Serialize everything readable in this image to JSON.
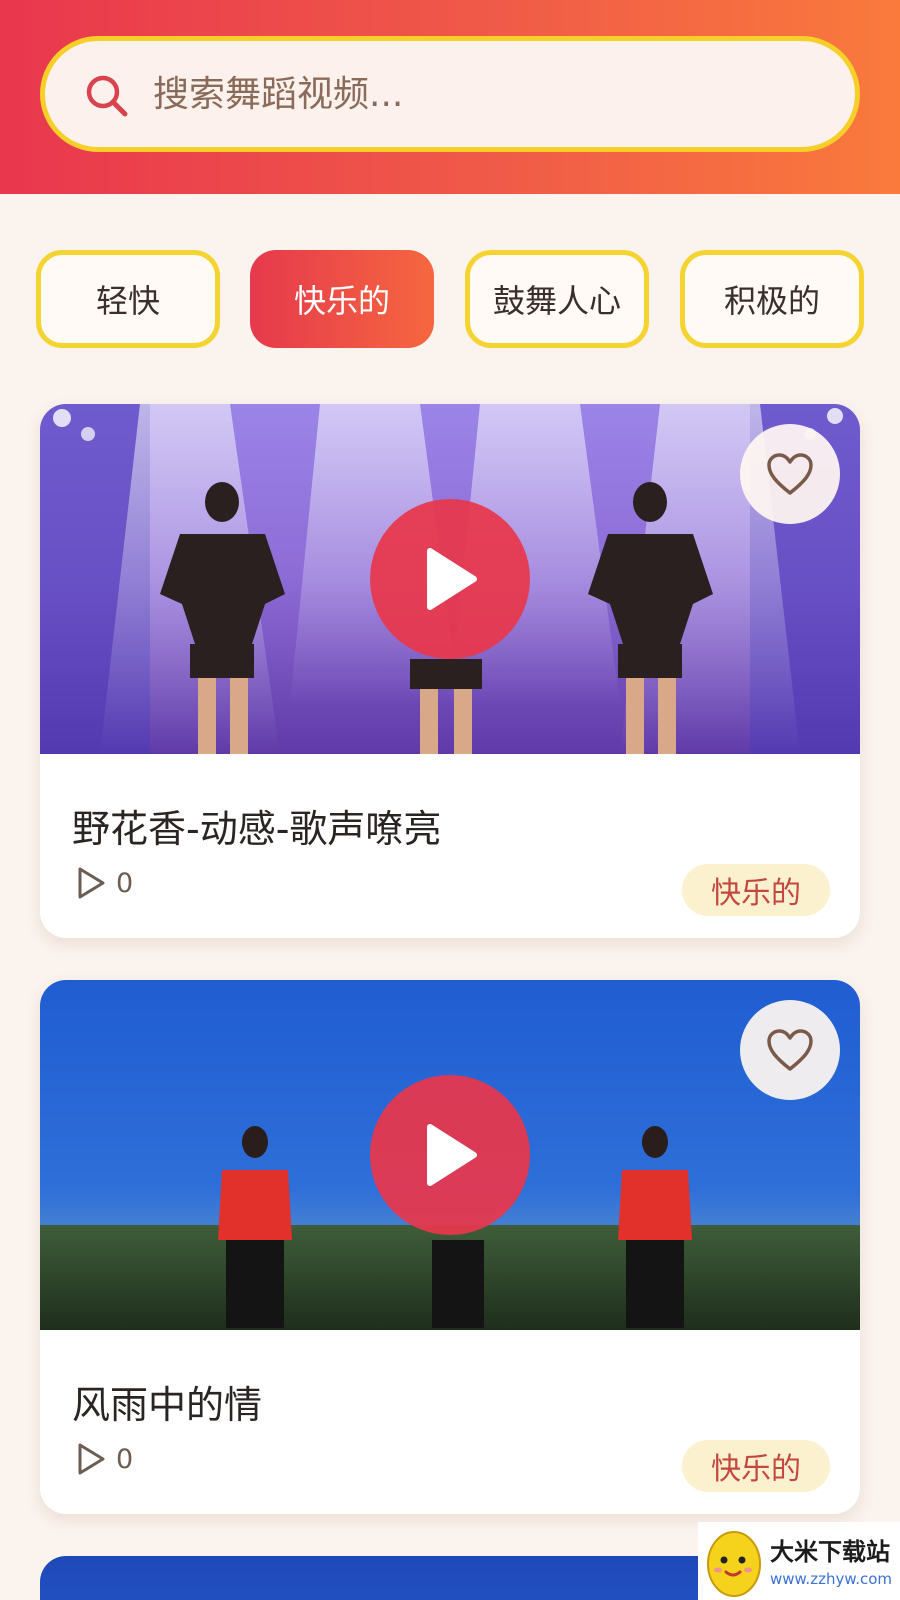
{
  "search": {
    "placeholder": "搜索舞蹈视频..."
  },
  "filters": [
    {
      "label": "轻快",
      "active": false
    },
    {
      "label": "快乐的",
      "active": true
    },
    {
      "label": "鼓舞人心",
      "active": false
    },
    {
      "label": "积极的",
      "active": false
    }
  ],
  "videos": [
    {
      "title": "野花香-动感-歌声嘹亮",
      "plays": "0",
      "tag": "快乐的"
    },
    {
      "title": "风雨中的情",
      "plays": "0",
      "tag": "快乐的"
    }
  ],
  "watermark": {
    "name": "大米下载站",
    "url": "www.zzhyw.com"
  },
  "colors": {
    "header_start": "#e9374e",
    "header_end": "#fa7a3c",
    "accent_yellow": "#f7cf29",
    "play_red": "#e8374b",
    "tag_bg": "#fcf1cf",
    "tag_text": "#c44840"
  },
  "icons": [
    "search-icon",
    "heart-icon",
    "play-icon",
    "play-count-icon"
  ]
}
